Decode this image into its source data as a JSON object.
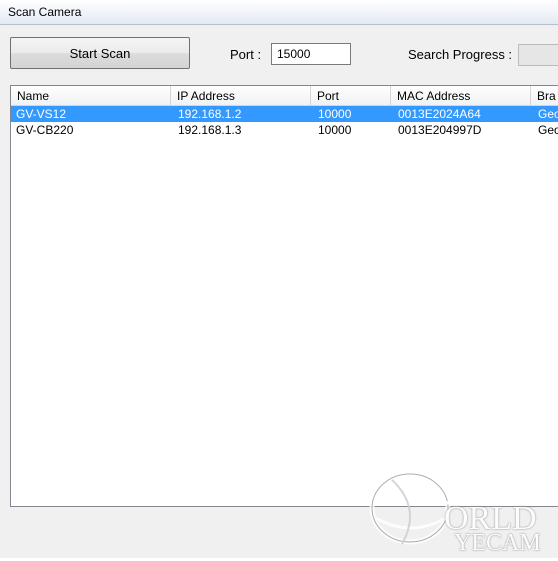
{
  "window": {
    "title": "Scan Camera"
  },
  "toolbar": {
    "start_scan_label": "Start Scan",
    "port_label": "Port :",
    "port_value": "15000",
    "progress_label": "Search Progress :",
    "progress": 0
  },
  "list": {
    "columns": [
      "Name",
      "IP Address",
      "Port",
      "MAC Address",
      "Bra"
    ],
    "rows": [
      {
        "name": "GV-VS12",
        "ip": "192.168.1.2",
        "port": "10000",
        "mac": "0013E2024A64",
        "brand": "Geo",
        "selected": true
      },
      {
        "name": "GV-CB220",
        "ip": "192.168.1.3",
        "port": "10000",
        "mac": "0013E204997D",
        "brand": "Geo",
        "selected": false
      }
    ]
  },
  "watermark": {
    "line1": "ORLD",
    "line2": "YECAM"
  }
}
